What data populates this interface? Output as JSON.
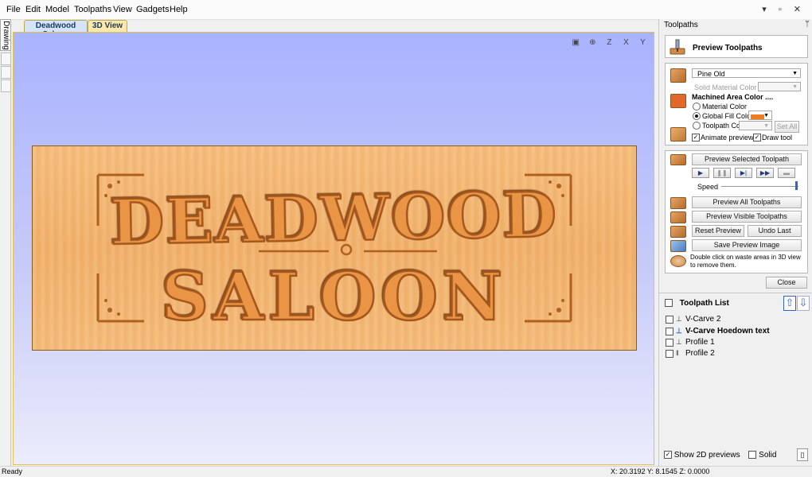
{
  "menu": [
    "File",
    "Edit",
    "Model",
    "Toolpaths",
    "View",
    "Gadgets",
    "Help"
  ],
  "window_controls": "▾ ▫ ✕",
  "left_tab": "Drawing",
  "doc_tabs": [
    "Deadwood Saloon",
    "3D View"
  ],
  "view_icons": [
    "▣",
    "⊕",
    "Z",
    "X",
    "Y"
  ],
  "sign": {
    "line1": "DEADWOOD",
    "line2": "SALOON"
  },
  "panel": {
    "title": "Toolpaths",
    "pin": "ᛘ",
    "header": "Preview Toolpaths",
    "material": {
      "selected": "Pine Old",
      "solid_color_label": "Solid Material Color",
      "machined_label": "Machined Area Color ....",
      "radio_material": "Material Color",
      "radio_global": "Global Fill Color",
      "radio_toolpath": "Toolpath Color",
      "set_all": "Set All",
      "animate": "Animate preview",
      "draw_tool": "Draw tool",
      "fill_color": "#f07b1d"
    },
    "preview": {
      "selected_btn": "Preview Selected Toolpath",
      "speed_label": "Speed",
      "all_btn": "Preview All Toolpaths",
      "visible_btn": "Preview Visible Toolpaths",
      "reset_btn": "Reset Preview",
      "undo_btn": "Undo Last",
      "save_btn": "Save Preview Image",
      "hint": "Double click on waste areas in 3D view to remove them.",
      "speed": 0.97
    },
    "close": "Close",
    "toolpath_list": {
      "title": "Toolpath List",
      "items": [
        {
          "name": "V-Carve 2",
          "bold": false
        },
        {
          "name": "V-Carve Hoedown text",
          "bold": true
        },
        {
          "name": "Profile 1",
          "bold": false
        },
        {
          "name": "Profile 2",
          "bold": false
        }
      ]
    },
    "show_2d": "Show 2D previews",
    "solid": "Solid"
  },
  "status": {
    "left": "Ready",
    "coords": "X: 20.3192 Y:  8.1545 Z:  0.0000"
  },
  "colors": {
    "accent": "#2e63c9",
    "wood": "#f3b874",
    "sky_top": "#a9b3ff"
  }
}
